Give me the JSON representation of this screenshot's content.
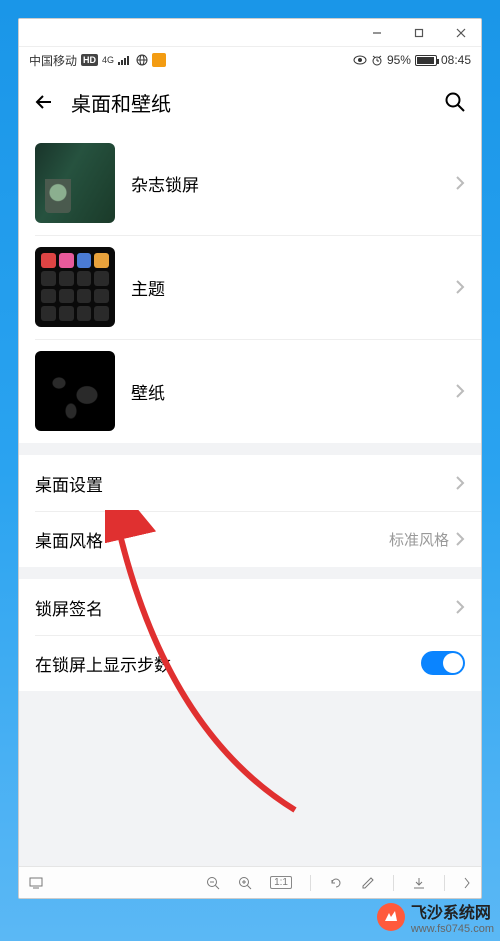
{
  "statusbar": {
    "carrier": "中国移动",
    "hd": "HD",
    "network": "4G",
    "battery_pct": "95%",
    "time": "08:45"
  },
  "header": {
    "title": "桌面和壁纸"
  },
  "group1": {
    "magazine": "杂志锁屏",
    "theme": "主题",
    "wallpaper": "壁纸"
  },
  "group2": {
    "home_settings": "桌面设置",
    "home_style_label": "桌面风格",
    "home_style_value": "标准风格"
  },
  "group3": {
    "lock_signature": "锁屏签名",
    "show_steps": "在锁屏上显示步数"
  },
  "toolbar": {
    "scale": "1:1"
  },
  "watermark": {
    "title": "飞沙系统网",
    "url": "www.fs0745.com"
  }
}
